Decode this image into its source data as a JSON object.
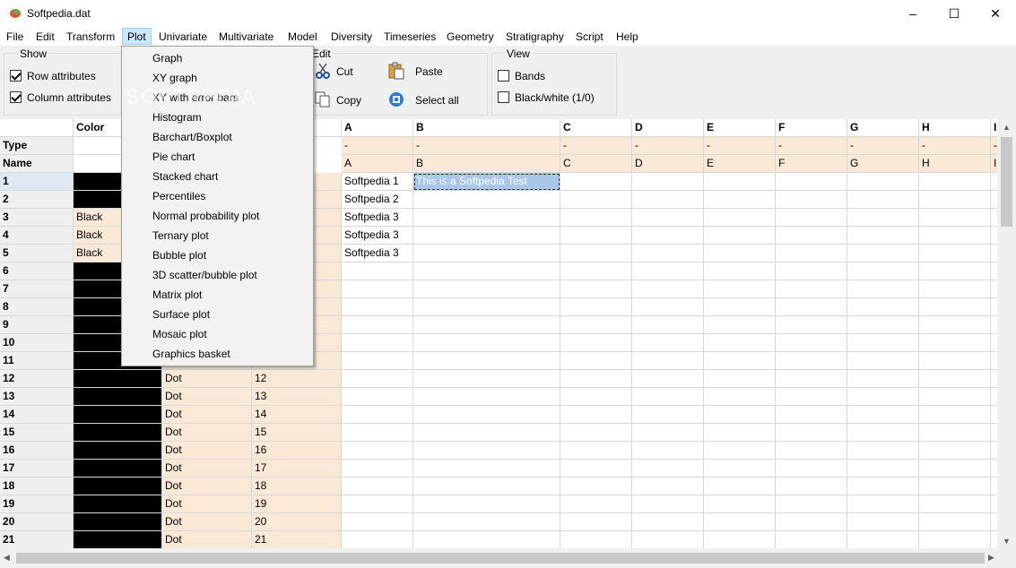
{
  "window": {
    "title": "Softpedia.dat",
    "minimize": "–",
    "maximize": "☐",
    "close": "✕"
  },
  "menu": [
    "File",
    "Edit",
    "Transform",
    "Plot",
    "Univariate",
    "Multivariate",
    "Model",
    "Diversity",
    "Timeseries",
    "Geometry",
    "Stratigraphy",
    "Script",
    "Help"
  ],
  "show_group": {
    "title": "Show",
    "row_attributes": "Row attributes",
    "column_attributes": "Column attributes"
  },
  "edit_group": {
    "title": "Edit",
    "cut": "Cut",
    "copy": "Copy",
    "paste": "Paste",
    "select_all": "Select all"
  },
  "view_group": {
    "title": "View",
    "bands": "Bands",
    "black_white": "Black/white (1/0)"
  },
  "plot_menu": [
    "Graph",
    "XY graph",
    "XY with error bars",
    "Histogram",
    "Barchart/Boxplot",
    "Pie chart",
    "Stacked chart",
    "Percentiles",
    "Normal probability plot",
    "Ternary plot",
    "Bubble plot",
    "3D scatter/bubble plot",
    "Matrix plot",
    "Surface plot",
    "Mosaic plot",
    "Graphics basket"
  ],
  "grid": {
    "header_color": "Color",
    "row_type": "Type",
    "row_name": "Name",
    "columns": [
      "A",
      "B",
      "C",
      "D",
      "E",
      "F",
      "G",
      "H",
      "I"
    ],
    "type_values": [
      "-",
      "-",
      "-",
      "-",
      "-",
      "-",
      "-",
      "-",
      "-"
    ],
    "name_values": [
      "A",
      "B",
      "C",
      "D",
      "E",
      "F",
      "G",
      "H",
      "I"
    ],
    "rows": [
      "1",
      "2",
      "3",
      "4",
      "5",
      "6",
      "7",
      "8",
      "9",
      "10",
      "11",
      "12",
      "13",
      "14",
      "15",
      "16",
      "17",
      "18",
      "19",
      "20",
      "21"
    ],
    "color_labels": [
      "",
      "",
      "Black",
      "Black",
      "Black"
    ],
    "symbol_label": "Dot",
    "col_a_values": [
      "Softpedia 1",
      "Softpedia 2",
      "Softpedia 3",
      "Softpedia 3",
      "Softpedia 3"
    ],
    "selected_cell": "This is a Softpedia Test",
    "labels_col": [
      "12",
      "13",
      "14",
      "15",
      "16",
      "17",
      "18",
      "19",
      "20",
      "21"
    ]
  },
  "watermark": "SOFTPEDIA"
}
